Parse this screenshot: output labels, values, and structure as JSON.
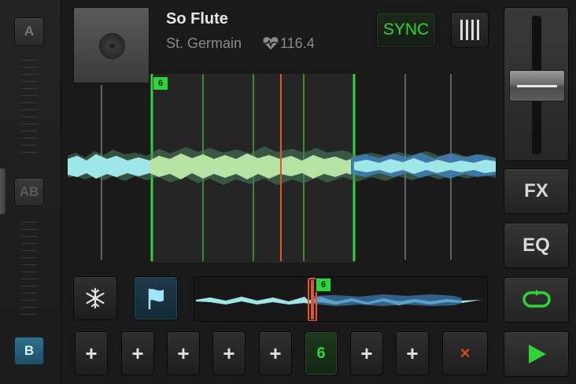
{
  "crossfader": {
    "deck_a_label": "A",
    "deck_ab_label": "AB",
    "deck_b_label": "B"
  },
  "track": {
    "title": "So Flute",
    "artist": "St. Germain",
    "bpm": "116.4",
    "bpm_icon": "heart-pulse-icon"
  },
  "top_buttons": {
    "sync_label": "SYNC",
    "grid_icon": "beat-grid-icon"
  },
  "waveform": {
    "cue_marker_label": "6"
  },
  "overview": {
    "cue_marker_label": "6"
  },
  "transport": {
    "freeze_icon": "snowflake-icon",
    "flag_icon": "flag-icon"
  },
  "cue_pads": {
    "slots": [
      "+",
      "+",
      "+",
      "+",
      "+",
      "6",
      "+",
      "+"
    ],
    "delete_label": "×"
  },
  "right_column": {
    "fx_label": "FX",
    "eq_label": "EQ",
    "loop_icon": "loop-icon",
    "play_icon": "play-icon"
  },
  "colors": {
    "accent_green": "#2fd33a",
    "playhead_orange": "#e0582a",
    "deck_b_blue": "#2d6f8a",
    "wave_cyan": "#9fe6e8",
    "wave_green": "#b6e3a3",
    "wave_blue": "#3f7fb8"
  }
}
